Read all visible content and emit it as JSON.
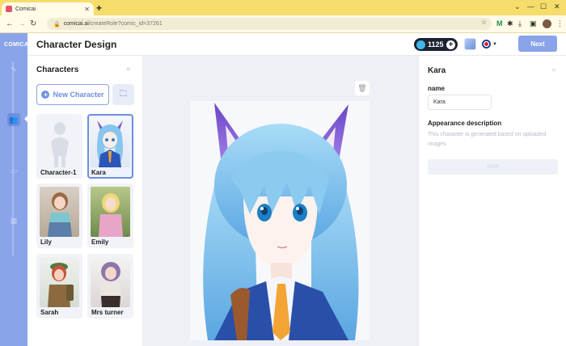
{
  "browser": {
    "tab_title": "Comicai",
    "url_main": "comicai.ai",
    "url_tail": "/createRole?comic_id=37261"
  },
  "rail": {
    "logo": "COMICAI",
    "items": [
      {
        "name": "edit-icon",
        "active": false
      },
      {
        "name": "characters-icon",
        "active": true
      },
      {
        "name": "scenes-icon",
        "active": false
      },
      {
        "name": "storyboard-icon",
        "active": false
      }
    ]
  },
  "header": {
    "title": "Character Design",
    "coins": "1125",
    "next_label": "Next"
  },
  "characters": {
    "title": "Characters",
    "new_label": "New Character",
    "items": [
      {
        "name": "Character-1",
        "selected": false
      },
      {
        "name": "Kara",
        "selected": true
      },
      {
        "name": "Lily",
        "selected": false
      },
      {
        "name": "Emily",
        "selected": false
      },
      {
        "name": "Sarah",
        "selected": false
      },
      {
        "name": "Mrs turner",
        "selected": false
      }
    ]
  },
  "details": {
    "title": "Kara",
    "name_label": "name",
    "name_value": "Kara",
    "appearance_label": "Appearance description",
    "appearance_text": "This character is generated based on uploaded images",
    "save_label": "Save"
  },
  "colors": {
    "accent": "#6f8ee0",
    "rail": "#8aa4ea",
    "browser_frame": "#f6dd6b"
  }
}
